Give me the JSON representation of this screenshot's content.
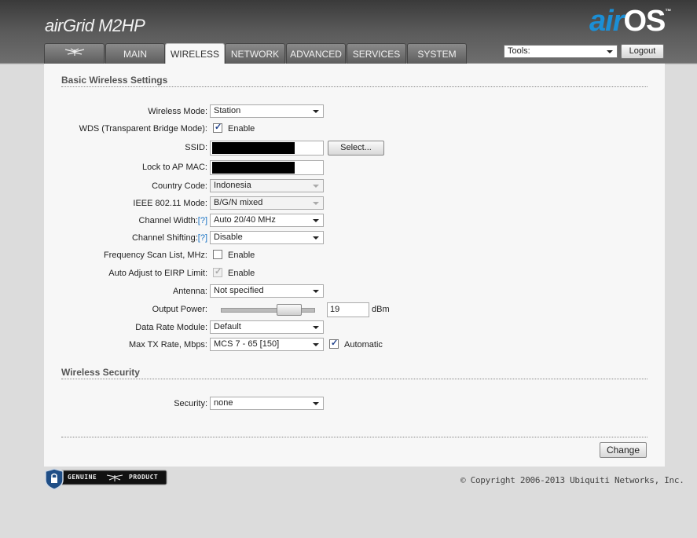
{
  "brand": {
    "product": "airGrid M2HP",
    "os_air": "air",
    "os_name": "OS",
    "tm": "™"
  },
  "tabs": [
    {
      "label": "",
      "icon": "ubiquiti-logo-icon"
    },
    {
      "label": "MAIN"
    },
    {
      "label": "WIRELESS",
      "active": true
    },
    {
      "label": "NETWORK"
    },
    {
      "label": "ADVANCED"
    },
    {
      "label": "SERVICES"
    },
    {
      "label": "SYSTEM"
    }
  ],
  "tools": {
    "value": "Tools:"
  },
  "logout_label": "Logout",
  "basic": {
    "title": "Basic Wireless Settings",
    "wireless_mode": {
      "label": "Wireless Mode:",
      "value": "Station"
    },
    "wds": {
      "label": "WDS (Transparent Bridge Mode):",
      "checkbox_label": "Enable",
      "checked": true
    },
    "ssid": {
      "label": "SSID:",
      "button": "Select..."
    },
    "lock_ap": {
      "label": "Lock to AP MAC:"
    },
    "country": {
      "label": "Country Code:",
      "value": "Indonesia"
    },
    "ieee": {
      "label": "IEEE 802.11 Mode:",
      "value": "B/G/N mixed"
    },
    "channel_width": {
      "label": "Channel Width:",
      "help": "[?]",
      "value": "Auto 20/40 MHz"
    },
    "channel_shifting": {
      "label": "Channel Shifting:",
      "help": "[?]",
      "value": "Disable"
    },
    "freq_scan": {
      "label": "Frequency Scan List, MHz:",
      "checkbox_label": "Enable",
      "checked": false
    },
    "auto_eirp": {
      "label": "Auto Adjust to EIRP Limit:",
      "checkbox_label": "Enable",
      "checked": true,
      "disabled": true
    },
    "antenna": {
      "label": "Antenna:",
      "value": "Not specified"
    },
    "output_power": {
      "label": "Output Power:",
      "value": "19",
      "unit": "dBm",
      "slider_fraction": 0.8
    },
    "data_rate": {
      "label": "Data Rate Module:",
      "value": "Default"
    },
    "max_tx": {
      "label": "Max TX Rate, Mbps:",
      "value": "MCS 7 - 65 [150]",
      "auto_label": "Automatic",
      "auto_checked": true
    }
  },
  "security": {
    "title": "Wireless Security",
    "label": "Security:",
    "value": "none"
  },
  "change_label": "Change",
  "footer": {
    "badge_left": "GENUINE",
    "badge_right": "PRODUCT",
    "copyright": "© Copyright 2006-2013 Ubiquiti Networks, Inc."
  }
}
